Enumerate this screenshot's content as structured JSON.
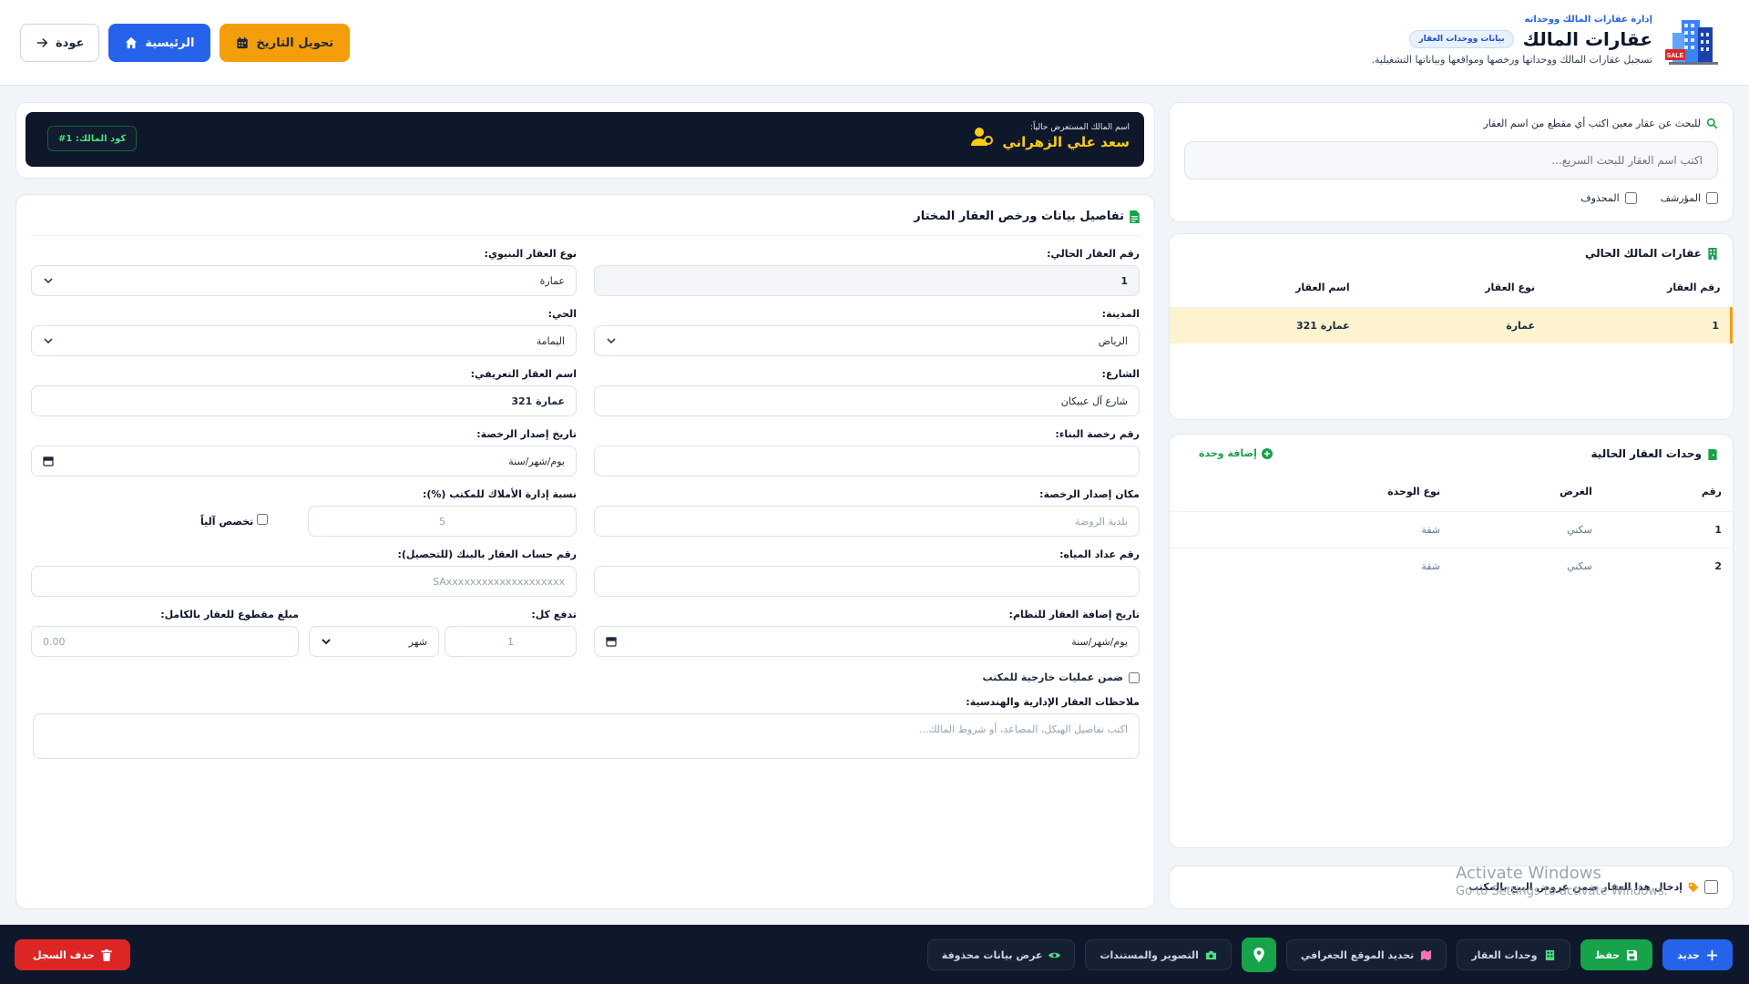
{
  "header": {
    "kicker": "إدارة عقارات المالك ووحداته",
    "title": "عقارات المالك",
    "badge": "بيانات ووحدات العقار",
    "subtitle": "تسجيل عقارات المالك ووحداتها ورخصها ومواقعها وبياناتها التشغيلية.",
    "back_label": "عودة",
    "home_label": "الرئيسية",
    "convert_label": "تحويل التاريخ"
  },
  "search": {
    "hint": "للبحث عن عقار معين اكتب أي مقطع من اسم العقار",
    "placeholder": "اكتب اسم العقار للبحث السريع...",
    "archived_label": "المؤرشف",
    "deleted_label": "المحذوف"
  },
  "properties_panel": {
    "title": "عقارات المالك الحالي",
    "columns": [
      "رقم العقار",
      "نوع العقار",
      "اسم العقار"
    ],
    "rows": [
      {
        "number": "1",
        "type": "عمارة",
        "name": "عمارة 321"
      }
    ]
  },
  "units_panel": {
    "title": "وحدات العقار الحالية",
    "add_label": "إضافة وحدة",
    "columns": [
      "رقم",
      "الغرض",
      "نوع الوحدة"
    ],
    "rows": [
      {
        "number": "1",
        "purpose": "سكني",
        "type": "شقة"
      },
      {
        "number": "2",
        "purpose": "سكني",
        "type": "شقة"
      }
    ]
  },
  "sale_offer": {
    "label": "إدخال هذا العقار ضمن عروض البيع بالمكتب"
  },
  "owner": {
    "label": "اسم المالك المستعرض حالياً:",
    "name": "سعد علي الزهراني",
    "code": "كود المالك: 1#"
  },
  "form": {
    "title": "تفاصيل بيانات ورخص العقار المختار",
    "property_number_label": "رقم العقار الحالي:",
    "property_number": "1",
    "structure_type_label": "نوع العقار البنيوي:",
    "structure_type": "عمارة",
    "city_label": "المدينة:",
    "city": "الرياض",
    "district_label": "الحي:",
    "district": "اليمامة",
    "street_label": "الشارع:",
    "street": "شارع آل عبيكان",
    "display_name_label": "اسم العقار التعريفي:",
    "display_name": "عمارة 321",
    "permit_number_label": "رقم رخصة البناء:",
    "permit_number": "",
    "permit_date_label": "تاريخ إصدار الرخصة:",
    "permit_date": "يوم/شهر/سنة",
    "permit_place_label": "مكان إصدار الرخصة:",
    "permit_place_placeholder": "بلدية الروضة",
    "mgmt_pct_label": "نسبة إدارة الأملاك للمكتب (%):",
    "mgmt_pct_placeholder": "5",
    "auto_allocate_label": "تخصص آلياً",
    "water_meter_label": "رقم عداد المياه:",
    "water_meter": "",
    "bank_account_label": "رقم حساب العقار بالبنك (للتحصيل):",
    "bank_account_placeholder": "SAxxxxxxxxxxxxxxxxxxxx",
    "added_date_label": "تاريخ إضافة العقار للنظام:",
    "added_date": "يوم/شهر/سنة",
    "pay_every_label": "تدفع كل:",
    "pay_every_placeholder": "1",
    "pay_period": "شهر",
    "lump_sum_label": "مبلغ مقطوع للعقار بالكامل:",
    "lump_sum_placeholder": "0.00",
    "external_ops_label": "ضمن عمليات خارجية للمكتب",
    "notes_label": "ملاحظات العقار الإدارية والهندسية:",
    "notes_placeholder": "اكتب تفاصيل الهيكل، المصاعد، أو شروط المالك..."
  },
  "footer": {
    "new_label": "جديد",
    "save_label": "حفظ",
    "units_label": "وحدات العقار",
    "geo_label": "تحديد الموقع الجغرافي",
    "docs_label": "التصوير والمستندات",
    "deleted_view_label": "عرض بيانات محذوفة",
    "delete_label": "حذف السجل"
  },
  "watermark": {
    "line1": "Activate Windows",
    "line2": "Go to Settings to activate Windows."
  },
  "colors": {
    "primary": "#2563eb",
    "accent": "#f59e0b",
    "success": "#16a34a",
    "danger": "#dc2626",
    "dark": "#0f172a"
  }
}
